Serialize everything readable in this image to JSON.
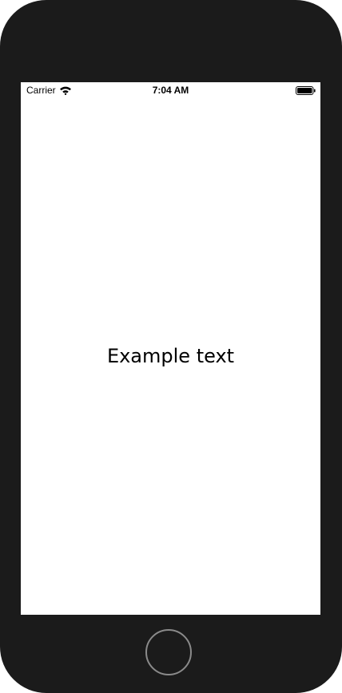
{
  "status_bar": {
    "carrier": "Carrier",
    "time": "7:04 AM",
    "icons": {
      "wifi": "wifi-icon",
      "battery": "battery-icon"
    }
  },
  "content": {
    "text": "Example text"
  },
  "colors": {
    "device_frame": "#1b1b1b",
    "screen_background": "#ffffff",
    "text": "#000000",
    "home_button_ring": "#8a8a8a"
  }
}
